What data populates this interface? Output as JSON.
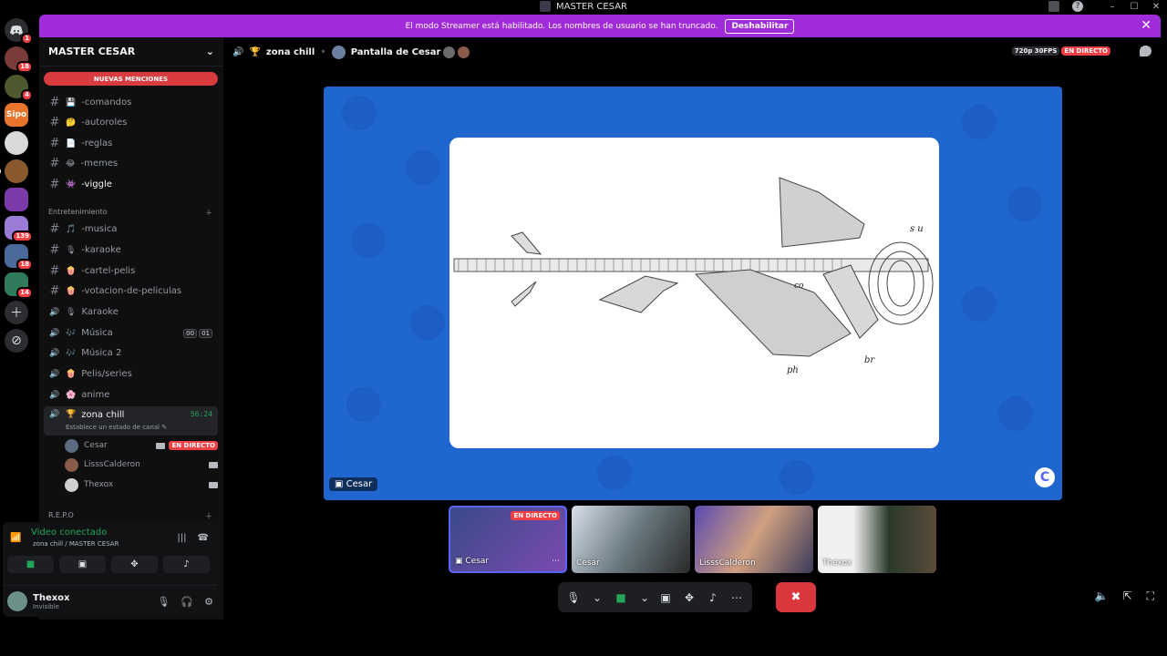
{
  "window": {
    "title": "MASTER CESAR"
  },
  "streamer_banner": {
    "text": "El modo Streamer está habilitado. Los nombres de usuario se han truncado.",
    "button": "Deshabilitar"
  },
  "server_rail": {
    "badges": [
      "1",
      "18",
      "4",
      "139",
      "18",
      "14"
    ]
  },
  "sidebar": {
    "server_name": "MASTER CESAR",
    "mentions_label": "NUEVAS MENCIONES",
    "channels_top": [
      {
        "icon": "#",
        "emoji": "💾",
        "label": "-comandos"
      },
      {
        "icon": "#",
        "emoji": "🤔",
        "label": "-autoroles"
      },
      {
        "icon": "#",
        "emoji": "📄",
        "label": "-reglas"
      },
      {
        "icon": "#",
        "emoji": "😂",
        "label": "-memes"
      },
      {
        "icon": "#",
        "emoji": "👾",
        "label": "-viggle"
      }
    ],
    "category_entretenimiento": "Entretenimiento",
    "channels_ent": [
      {
        "icon": "#",
        "emoji": "🎵",
        "label": "-musica"
      },
      {
        "icon": "#",
        "emoji": "🎙",
        "label": "-karaoke"
      },
      {
        "icon": "#",
        "emoji": "🍿",
        "label": "-cartel-pelis"
      },
      {
        "icon": "#",
        "emoji": "🍿",
        "label": "-votacion-de-peliculas"
      },
      {
        "icon": "🔊",
        "emoji": "🎙",
        "label": "Karaoke"
      },
      {
        "icon": "🔊",
        "emoji": "🎶",
        "label": "Música",
        "count_a": "00",
        "count_b": "01"
      },
      {
        "icon": "🔊",
        "emoji": "🎶",
        "label": "Música 2"
      },
      {
        "icon": "🔊",
        "emoji": "🍿",
        "label": "Pelis/series"
      },
      {
        "icon": "🔊",
        "emoji": "🌸",
        "label": "anime"
      }
    ],
    "active_channel": {
      "emoji": "🏆",
      "label": "zona chill",
      "timer": "56:24",
      "sub": "Establece un estado de canal"
    },
    "voice_users": [
      {
        "name": "Cesar",
        "live": "EN DIRECTO"
      },
      {
        "name": "LisssCalderon"
      },
      {
        "name": "Thexox"
      }
    ],
    "category_repo": "R.E.P.O"
  },
  "voice_panel": {
    "status": "Video conectado",
    "location": "zona chill / MASTER CESAR"
  },
  "user": {
    "name": "Thexox",
    "status": "Invisible"
  },
  "header": {
    "channel": "zona chill",
    "screen": "Pantalla de Cesar",
    "quality": "720p 30FPS",
    "live": "EN DIRECTO"
  },
  "stage": {
    "presenter": "Cesar"
  },
  "thumbnails": [
    {
      "name": "Cesar",
      "live": "EN DIRECTO",
      "type": "screen"
    },
    {
      "name": "Cesar",
      "type": "cam"
    },
    {
      "name": "LisssCalderon",
      "type": "cam"
    },
    {
      "name": "Thexox",
      "type": "cam"
    }
  ]
}
